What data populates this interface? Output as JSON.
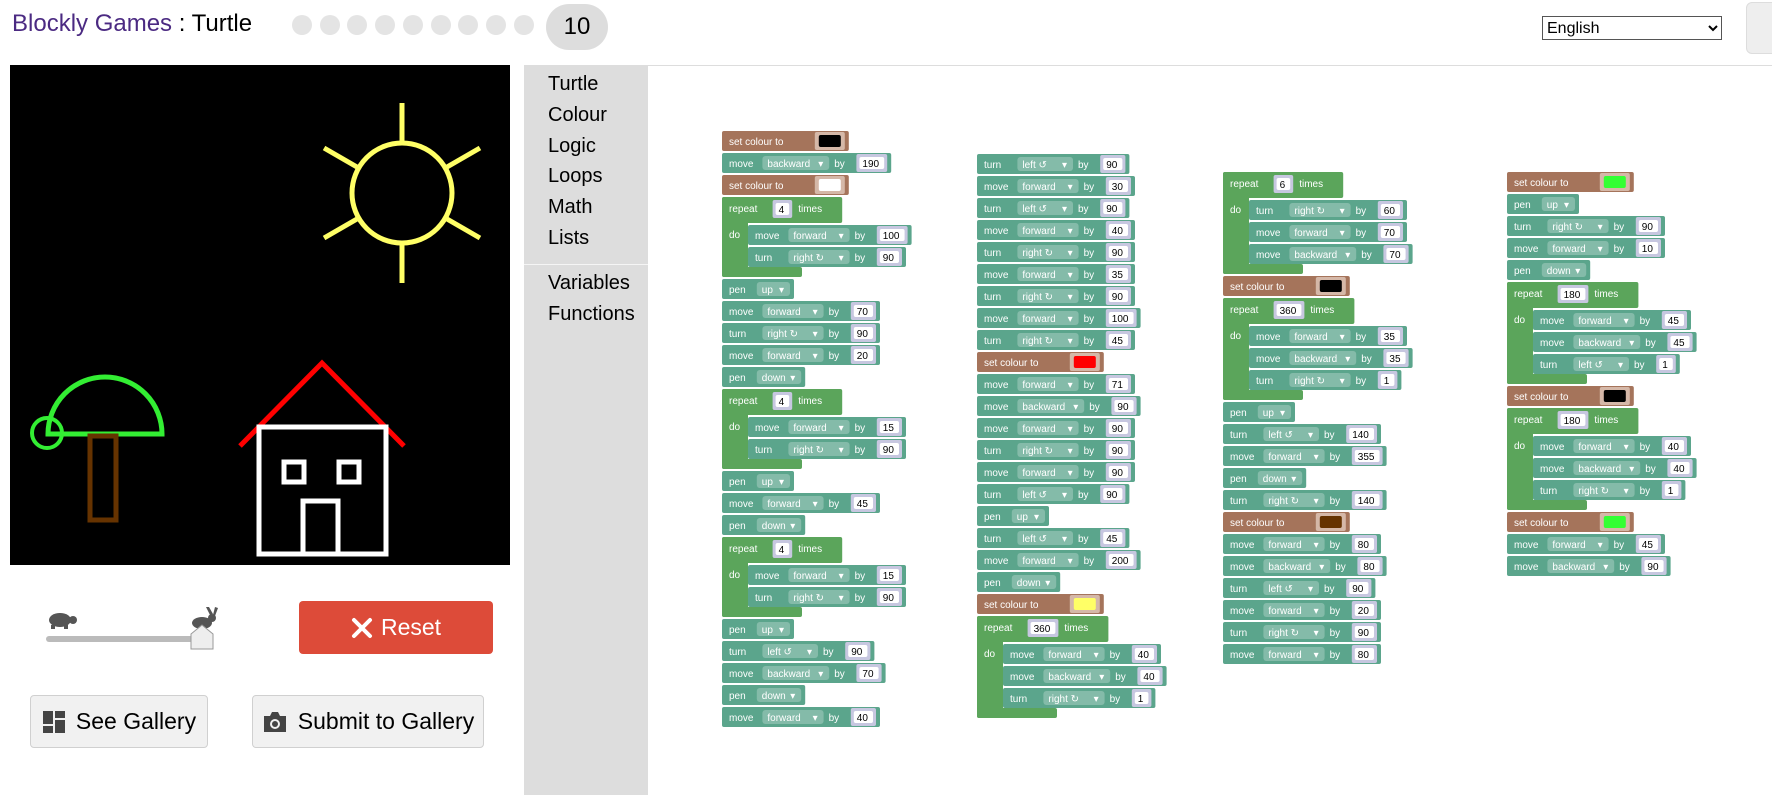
{
  "header": {
    "app_name": "Blockly Games",
    "separator": " : ",
    "game_name": "Turtle",
    "level_dots": 9,
    "current_level": "10",
    "language_options": [
      "English"
    ],
    "language_selected": "English"
  },
  "controls": {
    "reset_label": "Reset",
    "gallery_label": "See Gallery",
    "submit_label": "Submit to Gallery"
  },
  "toolbox": {
    "categories": [
      "Turtle",
      "Colour",
      "Logic",
      "Loops",
      "Math",
      "Lists"
    ],
    "categories2": [
      "Variables",
      "Functions"
    ]
  },
  "colors": {
    "canvas_bg": "#000000",
    "turtle_block": "#5ba58c",
    "loop_block": "#5ba55b",
    "colour_block": "#a5745b",
    "value_slot": "#c7c7e0",
    "reset_button": "#dd4b39"
  },
  "drawing": {
    "sun": "#ffff66",
    "tree_canopy": "#33ee33",
    "trunk": "#663300",
    "roof": "#ff0000",
    "house": "#ffffff"
  },
  "stacks": [
    [
      {
        "kind": "colour",
        "label": "set colour to",
        "colour": "#000000"
      },
      {
        "kind": "move",
        "label": "move",
        "dir": "backward",
        "by": "by",
        "value": "190"
      },
      {
        "kind": "colour",
        "label": "set colour to",
        "colour": "#ffffff"
      },
      {
        "kind": "repeat",
        "label": "repeat",
        "value": "4",
        "times": "times",
        "do": "do",
        "body": [
          {
            "kind": "move",
            "label": "move",
            "dir": "forward",
            "by": "by",
            "value": "100"
          },
          {
            "kind": "turn",
            "label": "turn",
            "dir": "right ↻",
            "by": "by",
            "value": "90"
          }
        ]
      },
      {
        "kind": "pen",
        "label": "pen",
        "state": "up"
      },
      {
        "kind": "move",
        "label": "move",
        "dir": "forward",
        "by": "by",
        "value": "70"
      },
      {
        "kind": "turn",
        "label": "turn",
        "dir": "right ↻",
        "by": "by",
        "value": "90"
      },
      {
        "kind": "move",
        "label": "move",
        "dir": "forward",
        "by": "by",
        "value": "20"
      },
      {
        "kind": "pen",
        "label": "pen",
        "state": "down"
      },
      {
        "kind": "repeat",
        "label": "repeat",
        "value": "4",
        "times": "times",
        "do": "do",
        "body": [
          {
            "kind": "move",
            "label": "move",
            "dir": "forward",
            "by": "by",
            "value": "15"
          },
          {
            "kind": "turn",
            "label": "turn",
            "dir": "right ↻",
            "by": "by",
            "value": "90"
          }
        ]
      },
      {
        "kind": "pen",
        "label": "pen",
        "state": "up"
      },
      {
        "kind": "move",
        "label": "move",
        "dir": "forward",
        "by": "by",
        "value": "45"
      },
      {
        "kind": "pen",
        "label": "pen",
        "state": "down"
      },
      {
        "kind": "repeat",
        "label": "repeat",
        "value": "4",
        "times": "times",
        "do": "do",
        "body": [
          {
            "kind": "move",
            "label": "move",
            "dir": "forward",
            "by": "by",
            "value": "15"
          },
          {
            "kind": "turn",
            "label": "turn",
            "dir": "right ↻",
            "by": "by",
            "value": "90"
          }
        ]
      },
      {
        "kind": "pen",
        "label": "pen",
        "state": "up"
      },
      {
        "kind": "turn",
        "label": "turn",
        "dir": "left ↺",
        "by": "by",
        "value": "90"
      },
      {
        "kind": "move",
        "label": "move",
        "dir": "backward",
        "by": "by",
        "value": "70"
      },
      {
        "kind": "pen",
        "label": "pen",
        "state": "down"
      },
      {
        "kind": "move",
        "label": "move",
        "dir": "forward",
        "by": "by",
        "value": "40"
      }
    ],
    [
      {
        "kind": "turn",
        "label": "turn",
        "dir": "left ↺",
        "by": "by",
        "value": "90"
      },
      {
        "kind": "move",
        "label": "move",
        "dir": "forward",
        "by": "by",
        "value": "30"
      },
      {
        "kind": "turn",
        "label": "turn",
        "dir": "left ↺",
        "by": "by",
        "value": "90"
      },
      {
        "kind": "move",
        "label": "move",
        "dir": "forward",
        "by": "by",
        "value": "40"
      },
      {
        "kind": "turn",
        "label": "turn",
        "dir": "right ↻",
        "by": "by",
        "value": "90"
      },
      {
        "kind": "move",
        "label": "move",
        "dir": "forward",
        "by": "by",
        "value": "35"
      },
      {
        "kind": "turn",
        "label": "turn",
        "dir": "right ↻",
        "by": "by",
        "value": "90"
      },
      {
        "kind": "move",
        "label": "move",
        "dir": "forward",
        "by": "by",
        "value": "100"
      },
      {
        "kind": "turn",
        "label": "turn",
        "dir": "right ↻",
        "by": "by",
        "value": "45"
      },
      {
        "kind": "colour",
        "label": "set colour to",
        "colour": "#ff0000"
      },
      {
        "kind": "move",
        "label": "move",
        "dir": "forward",
        "by": "by",
        "value": "71"
      },
      {
        "kind": "move",
        "label": "move",
        "dir": "backward",
        "by": "by",
        "value": "90"
      },
      {
        "kind": "move",
        "label": "move",
        "dir": "forward",
        "by": "by",
        "value": "90"
      },
      {
        "kind": "turn",
        "label": "turn",
        "dir": "right ↻",
        "by": "by",
        "value": "90"
      },
      {
        "kind": "move",
        "label": "move",
        "dir": "forward",
        "by": "by",
        "value": "90"
      },
      {
        "kind": "turn",
        "label": "turn",
        "dir": "left ↺",
        "by": "by",
        "value": "90"
      },
      {
        "kind": "pen",
        "label": "pen",
        "state": "up"
      },
      {
        "kind": "turn",
        "label": "turn",
        "dir": "left ↺",
        "by": "by",
        "value": "45"
      },
      {
        "kind": "move",
        "label": "move",
        "dir": "forward",
        "by": "by",
        "value": "200"
      },
      {
        "kind": "pen",
        "label": "pen",
        "state": "down"
      },
      {
        "kind": "colour",
        "label": "set colour to",
        "colour": "#ffff66"
      },
      {
        "kind": "repeat",
        "label": "repeat",
        "value": "360",
        "times": "times",
        "do": "do",
        "body": [
          {
            "kind": "move",
            "label": "move",
            "dir": "forward",
            "by": "by",
            "value": "40"
          },
          {
            "kind": "move",
            "label": "move",
            "dir": "backward",
            "by": "by",
            "value": "40"
          },
          {
            "kind": "turn",
            "label": "turn",
            "dir": "right ↻",
            "by": "by",
            "value": "1"
          }
        ]
      }
    ],
    [
      {
        "kind": "repeat",
        "label": "repeat",
        "value": "6",
        "times": "times",
        "do": "do",
        "body": [
          {
            "kind": "turn",
            "label": "turn",
            "dir": "right ↻",
            "by": "by",
            "value": "60"
          },
          {
            "kind": "move",
            "label": "move",
            "dir": "forward",
            "by": "by",
            "value": "70"
          },
          {
            "kind": "move",
            "label": "move",
            "dir": "backward",
            "by": "by",
            "value": "70"
          }
        ]
      },
      {
        "kind": "colour",
        "label": "set colour to",
        "colour": "#000000"
      },
      {
        "kind": "repeat",
        "label": "repeat",
        "value": "360",
        "times": "times",
        "do": "do",
        "body": [
          {
            "kind": "move",
            "label": "move",
            "dir": "forward",
            "by": "by",
            "value": "35"
          },
          {
            "kind": "move",
            "label": "move",
            "dir": "backward",
            "by": "by",
            "value": "35"
          },
          {
            "kind": "turn",
            "label": "turn",
            "dir": "right ↻",
            "by": "by",
            "value": "1"
          }
        ]
      },
      {
        "kind": "pen",
        "label": "pen",
        "state": "up"
      },
      {
        "kind": "turn",
        "label": "turn",
        "dir": "left ↺",
        "by": "by",
        "value": "140"
      },
      {
        "kind": "move",
        "label": "move",
        "dir": "forward",
        "by": "by",
        "value": "355"
      },
      {
        "kind": "pen",
        "label": "pen",
        "state": "down"
      },
      {
        "kind": "turn",
        "label": "turn",
        "dir": "right ↻",
        "by": "by",
        "value": "140"
      },
      {
        "kind": "colour",
        "label": "set colour to",
        "colour": "#663300"
      },
      {
        "kind": "move",
        "label": "move",
        "dir": "forward",
        "by": "by",
        "value": "80"
      },
      {
        "kind": "move",
        "label": "move",
        "dir": "backward",
        "by": "by",
        "value": "80"
      },
      {
        "kind": "turn",
        "label": "turn",
        "dir": "left ↺",
        "by": "by",
        "value": "90"
      },
      {
        "kind": "move",
        "label": "move",
        "dir": "forward",
        "by": "by",
        "value": "20"
      },
      {
        "kind": "turn",
        "label": "turn",
        "dir": "right ↻",
        "by": "by",
        "value": "90"
      },
      {
        "kind": "move",
        "label": "move",
        "dir": "forward",
        "by": "by",
        "value": "80"
      }
    ],
    [
      {
        "kind": "colour",
        "label": "set colour to",
        "colour": "#33ff33"
      },
      {
        "kind": "pen",
        "label": "pen",
        "state": "up"
      },
      {
        "kind": "turn",
        "label": "turn",
        "dir": "right ↻",
        "by": "by",
        "value": "90"
      },
      {
        "kind": "move",
        "label": "move",
        "dir": "forward",
        "by": "by",
        "value": "10"
      },
      {
        "kind": "pen",
        "label": "pen",
        "state": "down"
      },
      {
        "kind": "repeat",
        "label": "repeat",
        "value": "180",
        "times": "times",
        "do": "do",
        "body": [
          {
            "kind": "move",
            "label": "move",
            "dir": "forward",
            "by": "by",
            "value": "45"
          },
          {
            "kind": "move",
            "label": "move",
            "dir": "backward",
            "by": "by",
            "value": "45"
          },
          {
            "kind": "turn",
            "label": "turn",
            "dir": "left ↺",
            "by": "by",
            "value": "1"
          }
        ]
      },
      {
        "kind": "colour",
        "label": "set colour to",
        "colour": "#000000"
      },
      {
        "kind": "repeat",
        "label": "repeat",
        "value": "180",
        "times": "times",
        "do": "do",
        "body": [
          {
            "kind": "move",
            "label": "move",
            "dir": "forward",
            "by": "by",
            "value": "40"
          },
          {
            "kind": "move",
            "label": "move",
            "dir": "backward",
            "by": "by",
            "value": "40"
          },
          {
            "kind": "turn",
            "label": "turn",
            "dir": "right ↻",
            "by": "by",
            "value": "1"
          }
        ]
      },
      {
        "kind": "colour",
        "label": "set colour to",
        "colour": "#33ff33"
      },
      {
        "kind": "move",
        "label": "move",
        "dir": "forward",
        "by": "by",
        "value": "45"
      },
      {
        "kind": "move",
        "label": "move",
        "dir": "backward",
        "by": "by",
        "value": "90"
      }
    ]
  ]
}
